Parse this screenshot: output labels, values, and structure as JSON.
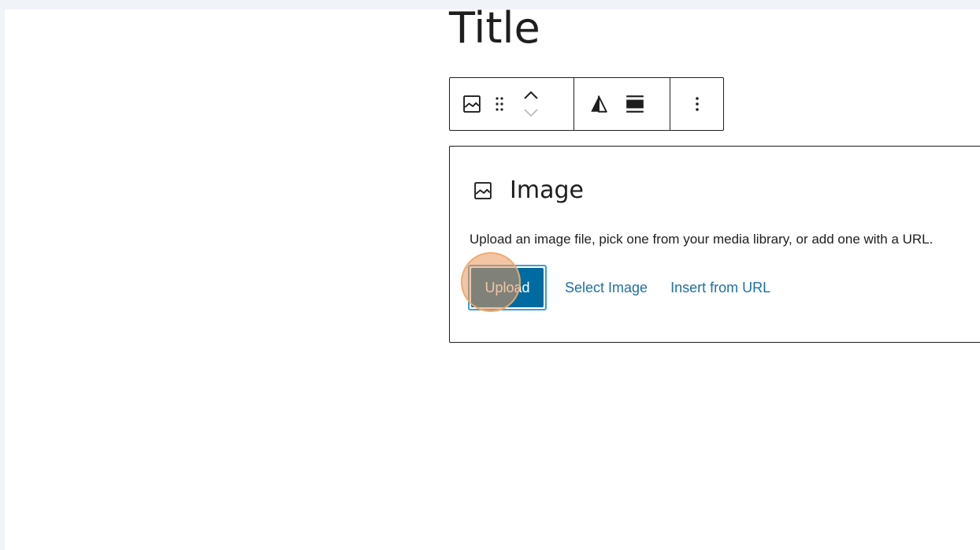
{
  "editor": {
    "post_title": "Title"
  },
  "block_toolbar": {
    "block_type_icon": "image-icon",
    "drag_icon": "drag-handle-icon",
    "move_up_icon": "chevron-up-icon",
    "move_down_icon": "chevron-down-icon",
    "change_alignment_icon": "align-contrast-icon",
    "block_align_icon": "align-wide-icon",
    "options_icon": "more-vertical-icon"
  },
  "image_block": {
    "label": "Image",
    "label_icon": "image-icon",
    "instructions": "Upload an image file, pick one from your media library, or add one with a URL.",
    "upload_label": "Upload",
    "select_image_label": "Select Image",
    "insert_url_label": "Insert from URL"
  },
  "colors": {
    "primary": "#006ba1",
    "link": "#1f6fa6",
    "focus_ring": "#3a9fd8",
    "click_marker": "#e9965a",
    "background": "#f0f3f8",
    "text": "#1e1e1e"
  }
}
